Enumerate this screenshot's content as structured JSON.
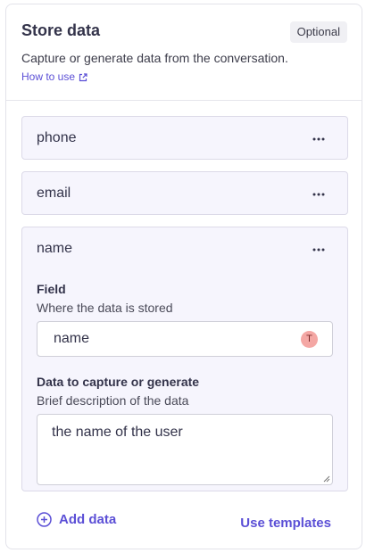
{
  "header": {
    "title": "Store data",
    "badge": "Optional",
    "description": "Capture or generate data from the conversation.",
    "link_label": "How to use"
  },
  "items": [
    {
      "title": "phone"
    },
    {
      "title": "email"
    },
    {
      "title": "name",
      "field_label": "Field",
      "field_help": "Where the data is stored",
      "field_value": "name",
      "field_badge": "T",
      "capture_label": "Data to capture or generate",
      "capture_help": "Brief description of the data",
      "capture_value": "the name of the user"
    }
  ],
  "footer": {
    "add_label": "Add data",
    "templates_label": "Use templates"
  },
  "colors": {
    "accent": "#5b4fd6",
    "item_bg": "#f6f5fd",
    "badge_bg": "#f4a7a4"
  }
}
